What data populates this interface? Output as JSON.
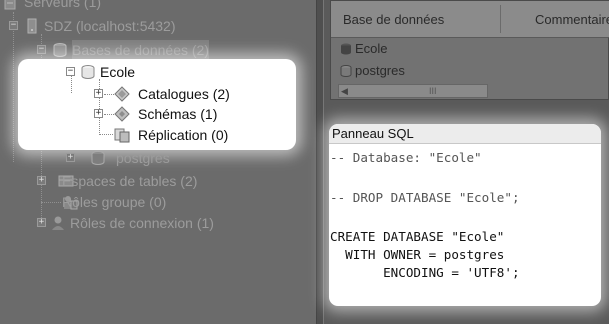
{
  "tree": {
    "servers": "Serveurs (1)",
    "server_sdz": "SDZ (localhost:5432)",
    "databases": "Bases de données (2)",
    "db_ecole": "Ecole",
    "catalogues": "Catalogues (2)",
    "schemas": "Schémas (1)",
    "replication": "Réplication (0)",
    "db_postgres": "postgres",
    "tablespaces": "Espaces de tables (2)",
    "group_roles": "Rôles groupe (0)",
    "login_roles": "Rôles de connexion (1)"
  },
  "grid": {
    "col_database": "Base de données",
    "col_comments": "Commentaires",
    "rows": [
      "Ecole",
      "postgres"
    ],
    "scroll_grip": "III"
  },
  "sql_panel": {
    "title": "Panneau SQL",
    "lines": [
      "-- Database: \"Ecole\"",
      "",
      "-- DROP DATABASE \"Ecole\";",
      "",
      "CREATE DATABASE \"Ecole\"",
      "  WITH OWNER = postgres",
      "       ENCODING = 'UTF8';"
    ]
  }
}
